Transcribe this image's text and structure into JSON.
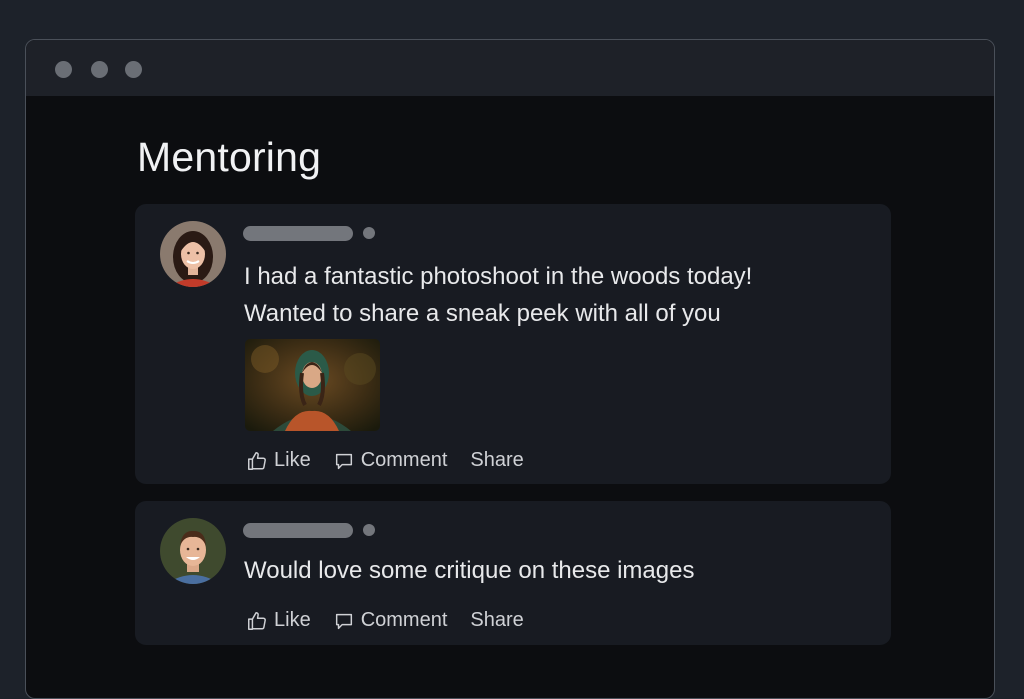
{
  "page": {
    "title": "Mentoring"
  },
  "posts": [
    {
      "text_lines": [
        "I had a fantastic photoshoot in the woods today!",
        "Wanted to share a sneak peek with all of you"
      ],
      "has_image": true,
      "actions": {
        "like": "Like",
        "comment": "Comment",
        "share": "Share"
      }
    },
    {
      "text_lines": [
        "Would love some critique on these images"
      ],
      "has_image": false,
      "actions": {
        "like": "Like",
        "comment": "Comment",
        "share": "Share"
      }
    }
  ],
  "icons": {
    "like": "thumbs-up-icon",
    "comment": "speech-bubble-icon"
  },
  "colors": {
    "background": "#1d222a",
    "window": "#0c0d10",
    "titlebar": "#1e2128",
    "card": "#181b22",
    "text": "#e8e9eb",
    "placeholder": "#73767c"
  }
}
